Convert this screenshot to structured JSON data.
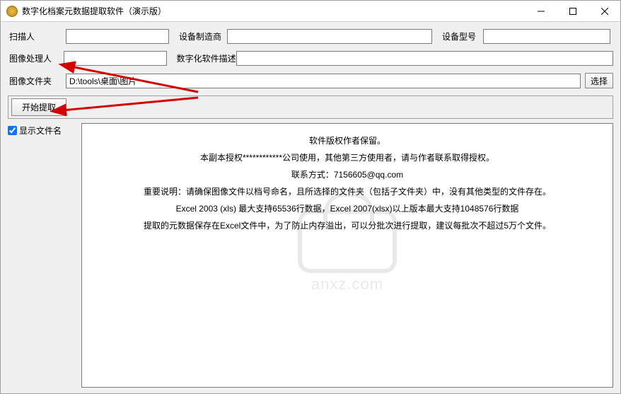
{
  "window": {
    "title": "数字化档案元数据提取软件（演示版）"
  },
  "form": {
    "scanner_label": "扫描人",
    "scanner_value": "",
    "manufacturer_label": "设备制造商",
    "manufacturer_value": "",
    "model_label": "设备型号",
    "model_value": "",
    "processor_label": "图像处理人",
    "processor_value": "",
    "software_desc_label": "数字化软件描述",
    "software_desc_value": "",
    "folder_label": "图像文件夹",
    "folder_value": "D:\\tools\\桌面\\图片",
    "choose_label": "选择",
    "extract_label": "开始提取",
    "show_filename_label": "显示文件名"
  },
  "info": {
    "line1": "软件版权作者保留。",
    "line2": "本副本授权************公司使用，其他第三方使用者，请与作者联系取得授权。",
    "line3": "联系方式：7156605@qq.com",
    "line4": "重要说明：请确保图像文件以档号命名，且所选择的文件夹（包括子文件夹）中，没有其他类型的文件存在。",
    "line5": "Excel 2003 (xls) 最大支持65536行数据，Excel 2007(xlsx)以上版本最大支持1048576行数据",
    "line6": "提取的元数据保存在Excel文件中，为了防止内存溢出，可以分批次进行提取，建议每批次不超过5万个文件。"
  },
  "watermark": "anxz.com"
}
